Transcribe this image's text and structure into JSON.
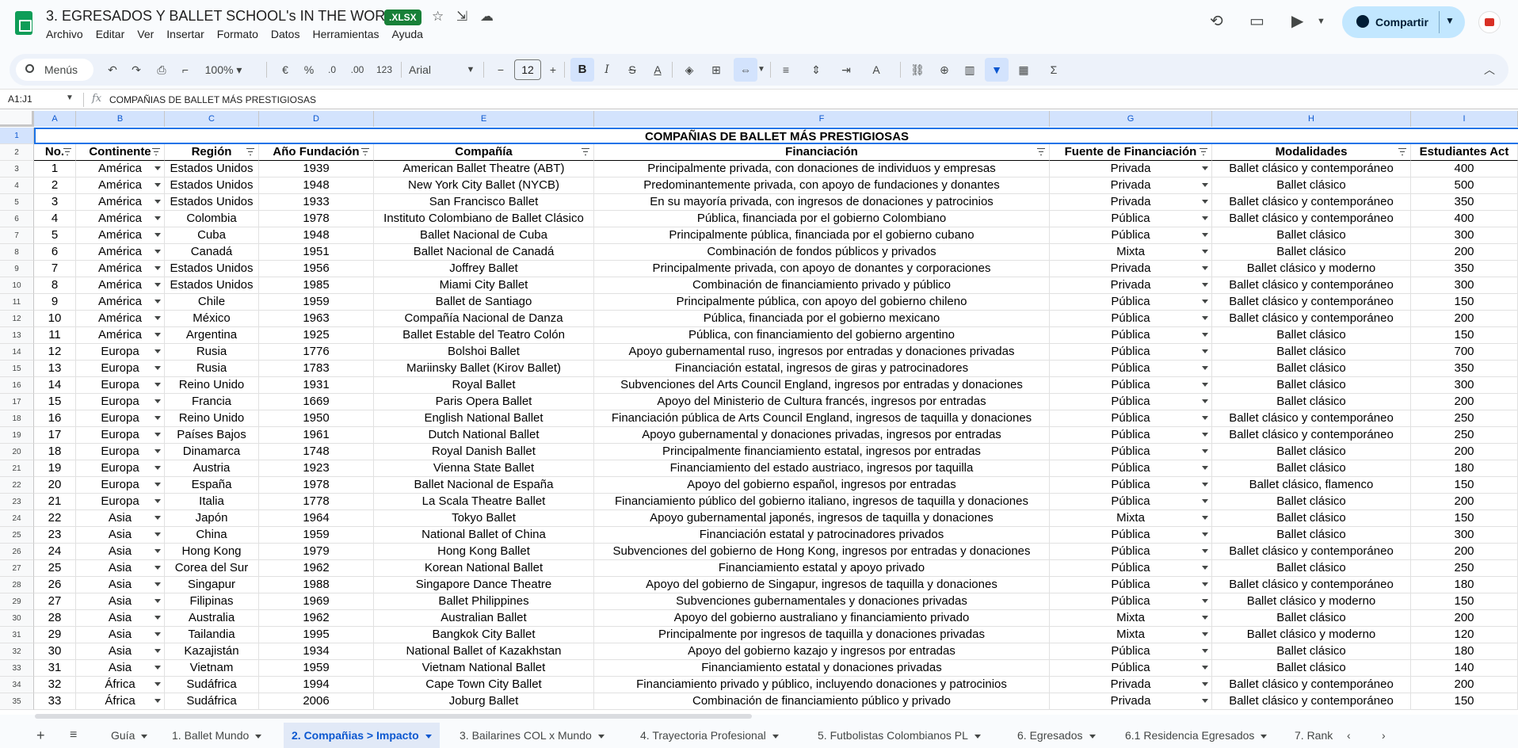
{
  "doc": {
    "title": "3. EGRESADOS Y BALLET SCHOOL's IN THE WORLD",
    "badge": ".XLSX",
    "menu": [
      "Archivo",
      "Editar",
      "Ver",
      "Insertar",
      "Formato",
      "Datos",
      "Herramientas",
      "Ayuda"
    ],
    "share_label": "Compartir"
  },
  "toolbar": {
    "menus_label": "Menús",
    "zoom": "100%",
    "currency": "€",
    "percent": "%",
    "dec_less": ".0",
    "dec_more": ".00",
    "number_format": "123",
    "font": "Arial",
    "font_size": "12",
    "minus": "−",
    "plus": "+",
    "sum": "Σ"
  },
  "formula_bar": {
    "name_box": "A1:J1",
    "fx": "fx",
    "content": "COMPAÑIAS DE BALLET MÁS PRESTIGIOSAS"
  },
  "sheet": {
    "columns": [
      "A",
      "B",
      "C",
      "D",
      "E",
      "F",
      "G",
      "H",
      "I"
    ],
    "title": "COMPAÑIAS DE BALLET MÁS PRESTIGIOSAS",
    "headers": [
      "No.",
      "Continente",
      "Región",
      "Año Fundación",
      "Compañía",
      "Financiación",
      "Fuente de Financiación",
      "Modalidades",
      "Estudiantes Act"
    ],
    "rows": [
      [
        "1",
        "América",
        "Estados Unidos",
        "1939",
        "American Ballet Theatre (ABT)",
        "Principalmente privada, con donaciones de individuos y empresas",
        "Privada",
        "Ballet clásico y contemporáneo",
        "400"
      ],
      [
        "2",
        "América",
        "Estados Unidos",
        "1948",
        "New York City Ballet (NYCB)",
        "Predominantemente privada, con apoyo de fundaciones y donantes",
        "Privada",
        "Ballet clásico",
        "500"
      ],
      [
        "3",
        "América",
        "Estados Unidos",
        "1933",
        "San Francisco Ballet",
        "En su mayoría privada, con ingresos de donaciones y patrocinios",
        "Privada",
        "Ballet clásico y contemporáneo",
        "350"
      ],
      [
        "4",
        "América",
        "Colombia",
        "1978",
        "Instituto Colombiano de Ballet Clásico",
        "Pública, financiada por el gobierno Colombiano",
        "Pública",
        "Ballet clásico y contemporáneo",
        "400"
      ],
      [
        "5",
        "América",
        "Cuba",
        "1948",
        "Ballet Nacional de Cuba",
        "Principalmente pública, financiada por el gobierno cubano",
        "Pública",
        "Ballet clásico",
        "300"
      ],
      [
        "6",
        "América",
        "Canadá",
        "1951",
        "Ballet Nacional de Canadá",
        "Combinación de fondos públicos y privados",
        "Mixta",
        "Ballet clásico",
        "200"
      ],
      [
        "7",
        "América",
        "Estados Unidos",
        "1956",
        "Joffrey Ballet",
        "Principalmente privada, con apoyo de donantes y corporaciones",
        "Privada",
        "Ballet clásico y moderno",
        "350"
      ],
      [
        "8",
        "América",
        "Estados Unidos",
        "1985",
        "Miami City Ballet",
        "Combinación de financiamiento privado y público",
        "Privada",
        "Ballet clásico y contemporáneo",
        "300"
      ],
      [
        "9",
        "América",
        "Chile",
        "1959",
        "Ballet de Santiago",
        "Principalmente pública, con apoyo del gobierno chileno",
        "Pública",
        "Ballet clásico y contemporáneo",
        "150"
      ],
      [
        "10",
        "América",
        "México",
        "1963",
        "Compañía Nacional de Danza",
        "Pública, financiada por el gobierno mexicano",
        "Pública",
        "Ballet clásico y contemporáneo",
        "200"
      ],
      [
        "11",
        "América",
        "Argentina",
        "1925",
        "Ballet Estable del Teatro Colón",
        "Pública, con financiamiento del gobierno argentino",
        "Pública",
        "Ballet clásico",
        "150"
      ],
      [
        "12",
        "Europa",
        "Rusia",
        "1776",
        "Bolshoi Ballet",
        "Apoyo gubernamental ruso, ingresos por entradas y donaciones privadas",
        "Pública",
        "Ballet clásico",
        "700"
      ],
      [
        "13",
        "Europa",
        "Rusia",
        "1783",
        "Mariinsky Ballet (Kirov Ballet)",
        "Financiación estatal, ingresos de giras y patrocinadores",
        "Pública",
        "Ballet clásico",
        "350"
      ],
      [
        "14",
        "Europa",
        "Reino Unido",
        "1931",
        "Royal Ballet",
        "Subvenciones del Arts Council England, ingresos por entradas y donaciones",
        "Pública",
        "Ballet clásico",
        "300"
      ],
      [
        "15",
        "Europa",
        "Francia",
        "1669",
        "Paris Opera Ballet",
        "Apoyo del Ministerio de Cultura francés, ingresos por entradas",
        "Pública",
        "Ballet clásico",
        "200"
      ],
      [
        "16",
        "Europa",
        "Reino Unido",
        "1950",
        "English National Ballet",
        "Financiación pública de Arts Council England, ingresos de taquilla y donaciones",
        "Pública",
        "Ballet clásico y contemporáneo",
        "250"
      ],
      [
        "17",
        "Europa",
        "Países Bajos",
        "1961",
        "Dutch National Ballet",
        "Apoyo gubernamental y donaciones privadas, ingresos por entradas",
        "Pública",
        "Ballet clásico y contemporáneo",
        "250"
      ],
      [
        "18",
        "Europa",
        "Dinamarca",
        "1748",
        "Royal Danish Ballet",
        "Principalmente financiamiento estatal, ingresos por entradas",
        "Pública",
        "Ballet clásico",
        "200"
      ],
      [
        "19",
        "Europa",
        "Austria",
        "1923",
        "Vienna State Ballet",
        "Financiamiento del estado austriaco, ingresos por taquilla",
        "Pública",
        "Ballet clásico",
        "180"
      ],
      [
        "20",
        "Europa",
        "España",
        "1978",
        "Ballet Nacional de España",
        "Apoyo del gobierno español, ingresos por entradas",
        "Pública",
        "Ballet clásico, flamenco",
        "150"
      ],
      [
        "21",
        "Europa",
        "Italia",
        "1778",
        "La Scala Theatre Ballet",
        "Financiamiento público del gobierno italiano, ingresos de taquilla y donaciones",
        "Pública",
        "Ballet clásico",
        "200"
      ],
      [
        "22",
        "Asia",
        "Japón",
        "1964",
        "Tokyo Ballet",
        "Apoyo gubernamental japonés, ingresos de taquilla y donaciones",
        "Mixta",
        "Ballet clásico",
        "150"
      ],
      [
        "23",
        "Asia",
        "China",
        "1959",
        "National Ballet of China",
        "Financiación estatal y patrocinadores privados",
        "Pública",
        "Ballet clásico",
        "300"
      ],
      [
        "24",
        "Asia",
        "Hong Kong",
        "1979",
        "Hong Kong Ballet",
        "Subvenciones del gobierno de Hong Kong, ingresos por entradas y donaciones",
        "Pública",
        "Ballet clásico y contemporáneo",
        "200"
      ],
      [
        "25",
        "Asia",
        "Corea del Sur",
        "1962",
        "Korean National Ballet",
        "Financiamiento estatal y apoyo privado",
        "Pública",
        "Ballet clásico",
        "250"
      ],
      [
        "26",
        "Asia",
        "Singapur",
        "1988",
        "Singapore Dance Theatre",
        "Apoyo del gobierno de Singapur, ingresos de taquilla y donaciones",
        "Pública",
        "Ballet clásico y contemporáneo",
        "180"
      ],
      [
        "27",
        "Asia",
        "Filipinas",
        "1969",
        "Ballet Philippines",
        "Subvenciones gubernamentales y donaciones privadas",
        "Pública",
        "Ballet clásico y moderno",
        "150"
      ],
      [
        "28",
        "Asia",
        "Australia",
        "1962",
        "Australian Ballet",
        "Apoyo del gobierno australiano y financiamiento privado",
        "Mixta",
        "Ballet clásico",
        "200"
      ],
      [
        "29",
        "Asia",
        "Tailandia",
        "1995",
        "Bangkok City Ballet",
        "Principalmente por ingresos de taquilla y donaciones privadas",
        "Mixta",
        "Ballet clásico y moderno",
        "120"
      ],
      [
        "30",
        "Asia",
        "Kazajistán",
        "1934",
        "National Ballet of Kazakhstan",
        "Apoyo del gobierno kazajo y ingresos por entradas",
        "Pública",
        "Ballet clásico",
        "180"
      ],
      [
        "31",
        "Asia",
        "Vietnam",
        "1959",
        "Vietnam National Ballet",
        "Financiamiento estatal y donaciones privadas",
        "Pública",
        "Ballet clásico",
        "140"
      ],
      [
        "32",
        "África",
        "Sudáfrica",
        "1994",
        "Cape Town City Ballet",
        "Financiamiento privado y público, incluyendo donaciones y patrocinios",
        "Privada",
        "Ballet clásico y contemporáneo",
        "200"
      ],
      [
        "33",
        "África",
        "Sudáfrica",
        "2006",
        "Joburg Ballet",
        "Combinación de financiamiento público y privado",
        "Privada",
        "Ballet clásico y contemporáneo",
        "150"
      ]
    ]
  },
  "tabs": [
    "Guía",
    "1. Ballet Mundo",
    "2. Compañias > Impacto",
    "3. Bailarines COL x Mundo",
    "4. Trayectoria Profesional",
    "5. Futbolistas Colombianos PL",
    "6. Egresados",
    "6.1 Residencia Egresados",
    "7. Rank"
  ],
  "active_tab": "2. Compañias > Impacto",
  "colors": {
    "accent": "#0b57d0",
    "share_bg": "#c2e7ff",
    "xlsx_badge": "#188038",
    "sheets_green": "#0f9d58"
  }
}
